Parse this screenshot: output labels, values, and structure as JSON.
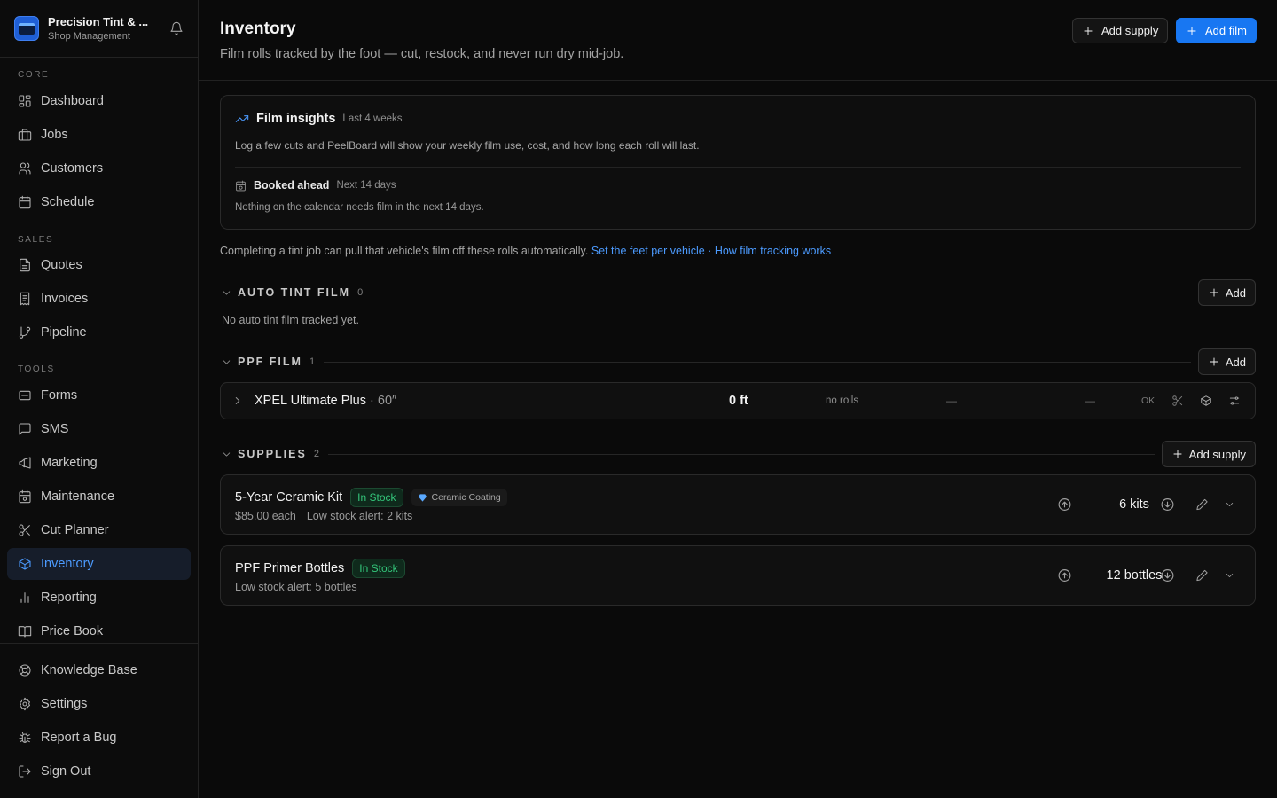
{
  "app": {
    "name": "Precision Tint & ...",
    "subtitle": "Shop Management"
  },
  "sidebar": {
    "sections": [
      {
        "label": "CORE",
        "items": [
          {
            "label": "Dashboard",
            "icon": "dashboard-icon"
          },
          {
            "label": "Jobs",
            "icon": "briefcase-icon"
          },
          {
            "label": "Customers",
            "icon": "users-icon"
          },
          {
            "label": "Schedule",
            "icon": "calendar-icon"
          }
        ]
      },
      {
        "label": "SALES",
        "items": [
          {
            "label": "Quotes",
            "icon": "document-icon"
          },
          {
            "label": "Invoices",
            "icon": "receipt-icon"
          },
          {
            "label": "Pipeline",
            "icon": "git-branch-icon"
          }
        ]
      },
      {
        "label": "TOOLS",
        "items": [
          {
            "label": "Forms",
            "icon": "form-icon"
          },
          {
            "label": "SMS",
            "icon": "message-icon"
          },
          {
            "label": "Marketing",
            "icon": "megaphone-icon"
          },
          {
            "label": "Maintenance",
            "icon": "calendar-check-icon"
          },
          {
            "label": "Cut Planner",
            "icon": "scissors-icon"
          },
          {
            "label": "Inventory",
            "icon": "package-icon",
            "active": true
          },
          {
            "label": "Reporting",
            "icon": "bar-chart-icon"
          },
          {
            "label": "Price Book",
            "icon": "book-icon"
          }
        ]
      }
    ],
    "footer": [
      {
        "label": "Knowledge Base",
        "icon": "lifebuoy-icon"
      },
      {
        "label": "Settings",
        "icon": "gear-icon"
      },
      {
        "label": "Report a Bug",
        "icon": "bug-icon"
      },
      {
        "label": "Sign Out",
        "icon": "logout-icon"
      }
    ]
  },
  "header": {
    "title": "Inventory",
    "subtitle": "Film rolls tracked by the foot — cut, restock, and never run dry mid-job.",
    "add_supply_label": "Add supply",
    "add_film_label": "Add film"
  },
  "insights": {
    "title": "Film insights",
    "period": "Last 4 weeks",
    "text": "Log a few cuts and PeelBoard will show your weekly film use, cost, and how long each roll will last.",
    "booked_title": "Booked ahead",
    "booked_period": "Next 14 days",
    "booked_text": "Nothing on the calendar needs film in the next 14 days."
  },
  "note": {
    "text": "Completing a tint job can pull that vehicle's film off these rolls automatically.",
    "link1": "Set the feet per vehicle",
    "sep": "·",
    "link2": "How film tracking works"
  },
  "auto_tint": {
    "title": "AUTO TINT FILM",
    "count": "0",
    "add_label": "Add",
    "empty_text": "No auto tint film tracked yet."
  },
  "ppf": {
    "title": "PPF FILM",
    "count": "1",
    "add_label": "Add",
    "rows": [
      {
        "name": "XPEL Ultimate Plus",
        "sep": "·",
        "width": "60″",
        "feet": "0 ft",
        "rolls": "no rolls",
        "dash1": "—",
        "dash2": "—",
        "status": "OK"
      }
    ]
  },
  "supplies": {
    "title": "SUPPLIES",
    "count": "2",
    "add_label": "Add supply",
    "items": [
      {
        "name": "5-Year Ceramic Kit",
        "status": "In Stock",
        "category": "Ceramic Coating",
        "price": "$85.00 each",
        "alert": "Low stock alert: 2 kits",
        "qty": "6 kits"
      },
      {
        "name": "PPF Primer Bottles",
        "status": "In Stock",
        "alert": "Low stock alert: 5 bottles",
        "qty": "12 bottles"
      }
    ]
  },
  "colors": {
    "accent": "#1877f2",
    "link": "#4c9bff",
    "in_stock": "#34c77b",
    "background": "#0a0a0a"
  }
}
